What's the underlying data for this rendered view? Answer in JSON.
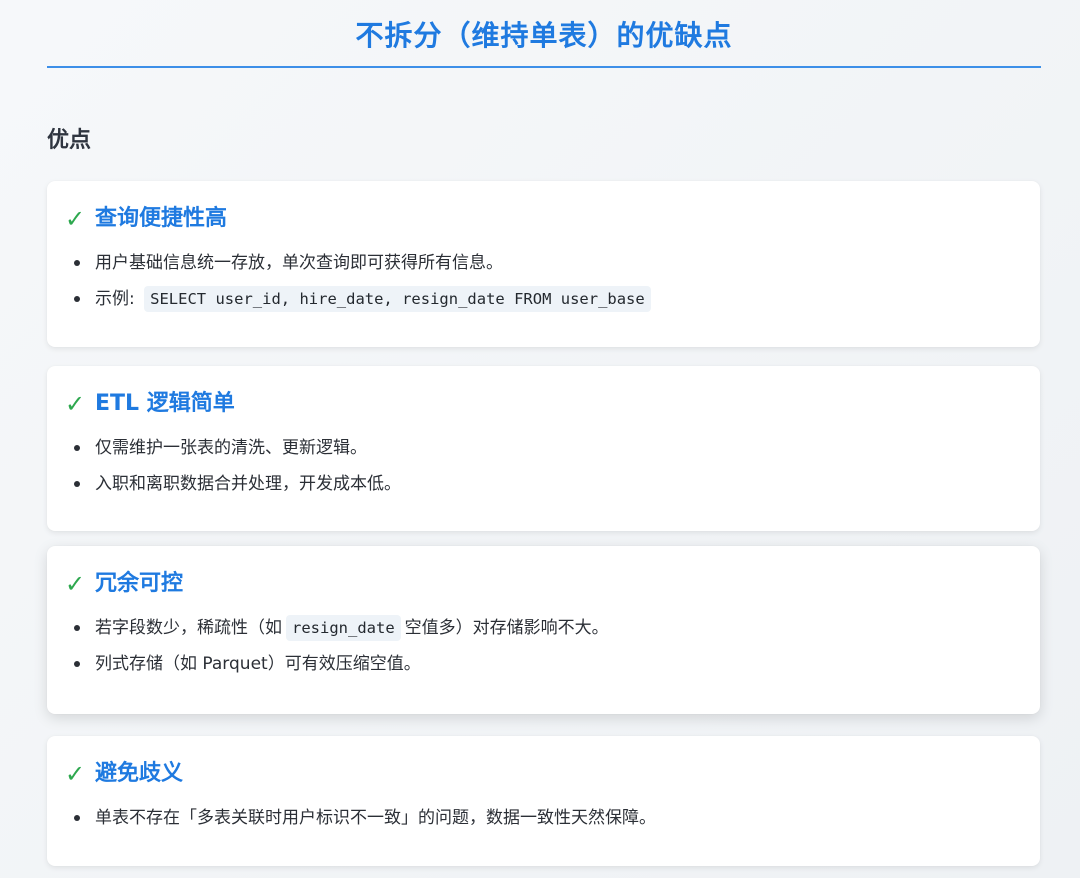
{
  "title": "不拆分（维持单表）的优缺点",
  "section_heading": "优点",
  "colors": {
    "title": "#1f7ae0",
    "check": "#2ea84f",
    "rule": "#3d8fe8"
  },
  "cards": [
    {
      "icon": "check-icon",
      "check_glyph": "✓",
      "title": "查询便捷性高",
      "items": [
        {
          "text": "用户基础信息统一存放，单次查询即可获得所有信息。"
        },
        {
          "prefix": "示例: ",
          "code": "SELECT user_id, hire_date, resign_date FROM user_base",
          "suffix": ""
        }
      ]
    },
    {
      "icon": "check-icon",
      "check_glyph": "✓",
      "title": "ETL 逻辑简单",
      "items": [
        {
          "text": "仅需维护一张表的清洗、更新逻辑。"
        },
        {
          "text": "入职和离职数据合并处理，开发成本低。"
        }
      ]
    },
    {
      "icon": "check-icon",
      "check_glyph": "✓",
      "title": "冗余可控",
      "items": [
        {
          "prefix": "若字段数少，稀疏性（如",
          "code": "resign_date",
          "suffix": "空值多）对存储影响不大。"
        },
        {
          "text": "列式存储（如 Parquet）可有效压缩空值。"
        }
      ]
    },
    {
      "icon": "check-icon",
      "check_glyph": "✓",
      "title": "避免歧义",
      "items": [
        {
          "text": "单表不存在「多表关联时用户标识不一致」的问题，数据一致性天然保障。"
        }
      ]
    }
  ]
}
